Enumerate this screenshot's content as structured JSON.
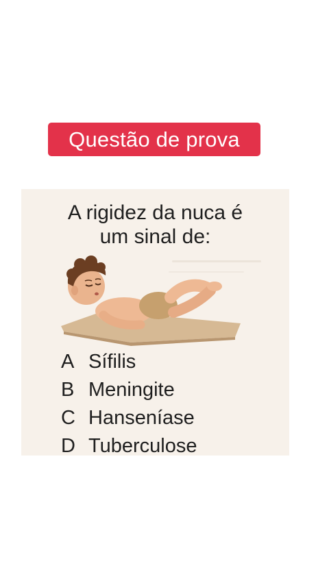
{
  "badge": {
    "label": "Questão de prova"
  },
  "question": {
    "line1": "A rigidez da nuca é",
    "line2": "um sinal de:"
  },
  "illustration": {
    "icon": "baby-lying-on-mat-icon"
  },
  "options": [
    {
      "letter": "A",
      "text": "Sífilis"
    },
    {
      "letter": "B",
      "text": "Meningite"
    },
    {
      "letter": "C",
      "text": "Hanseníase"
    },
    {
      "letter": "D",
      "text": "Tuberculose"
    }
  ],
  "colors": {
    "badge_background": "#e3324a",
    "card_background": "#f7f1ea",
    "text": "#1e1e1e"
  }
}
